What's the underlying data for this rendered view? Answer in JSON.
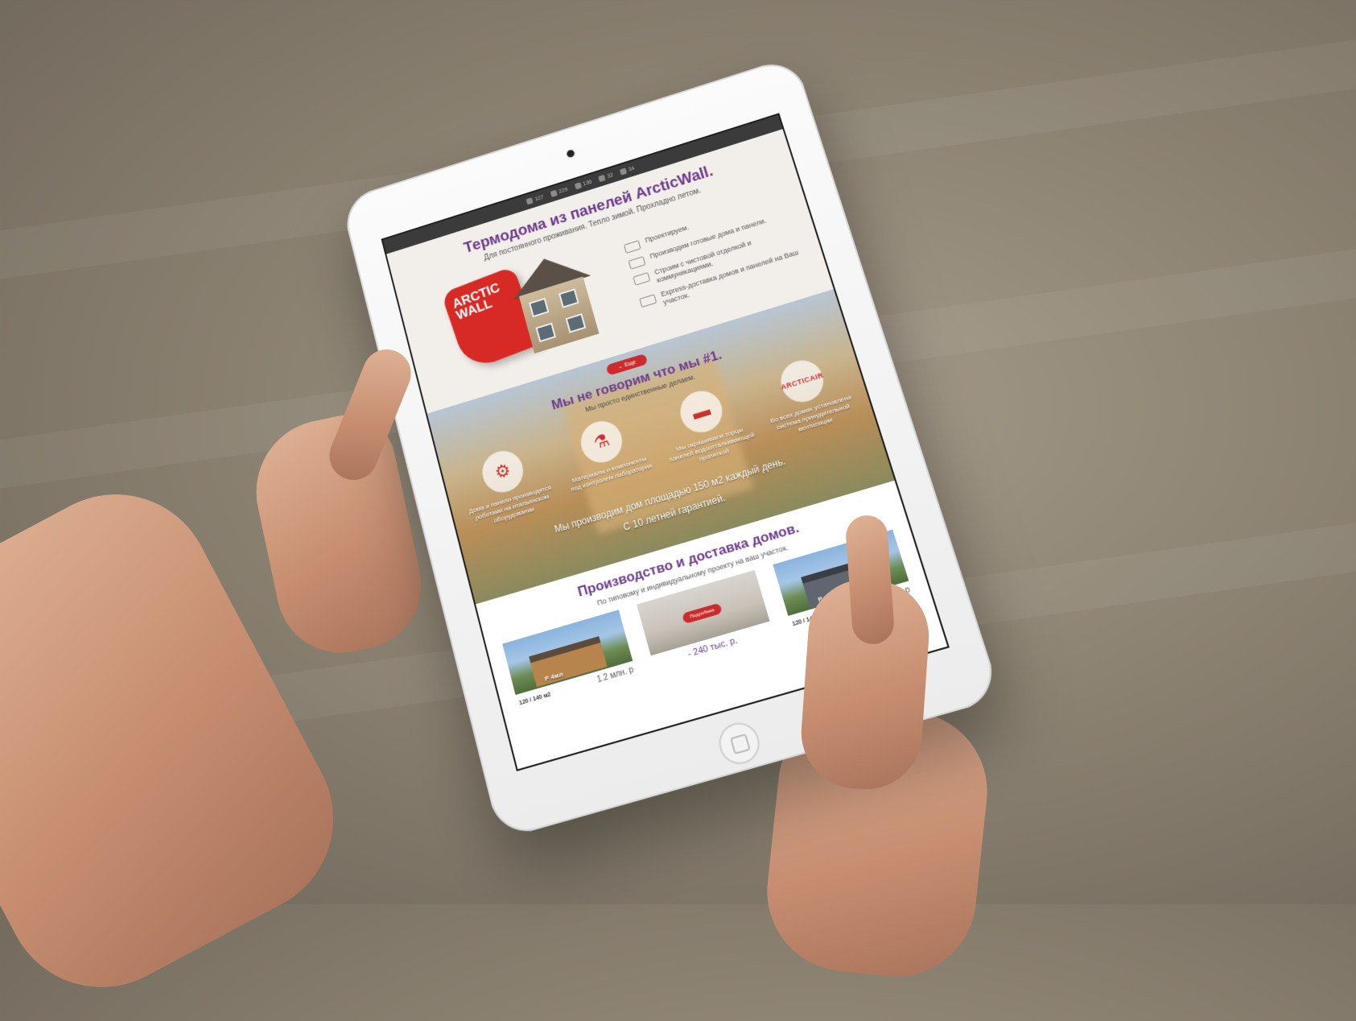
{
  "social": [
    {
      "icon": "twitter-icon",
      "count": "127"
    },
    {
      "icon": "facebook-icon",
      "count": "229"
    },
    {
      "icon": "vk-icon",
      "count": "136"
    },
    {
      "icon": "google-plus-icon",
      "count": "32"
    },
    {
      "icon": "odnoklassniki-icon",
      "count": "34"
    }
  ],
  "hero": {
    "title": "Термодома из панелей ArcticWall.",
    "subtitle": "Для постоянного проживания. Тепло зимой. Прохладно летом.",
    "logo_line1": "ARCTIC",
    "logo_line2": "WALL",
    "features": [
      "Проектируем.",
      "Производим готовые дома и панели.",
      "Строим с чистовой отделкой и коммуникациями.",
      "Express-доставка домов и панелей на Ваш участок."
    ]
  },
  "banner": {
    "more_label": "Еще",
    "title": "Мы не говорим что мы #1.",
    "subtitle": "Мы просто единственные делаем.",
    "advantages": [
      {
        "icon": "robot-arm-icon",
        "glyph": "⚙",
        "text": "Дома и панели производятся роботами на итальянском оборудовании"
      },
      {
        "icon": "lab-flask-icon",
        "glyph": "⚗",
        "text": "Материалы и компоненты под контролем лаборатории"
      },
      {
        "icon": "paint-roller-icon",
        "glyph": "▬",
        "text": "Мы окрашиваем торцы панелей водоотталкивающей пропиткой"
      },
      {
        "icon": "arcticair-fan-icon",
        "glyph": "ARCTICAIR",
        "text": "Во всех домах установлена система принудительной вентиляции"
      }
    ],
    "footer_line1": "Мы производим дом площадью 150 м2 каждый день.",
    "footer_line2": "С 10 летней гарантией."
  },
  "production": {
    "title": "Производство и доставка домов.",
    "subtitle": "По типовому и индивидуальному проекту на ваш участок.",
    "cards": [
      {
        "area": "120 / 140 м2",
        "price": "1.2 млн. р",
        "tag": "Р 4мл"
      },
      {
        "button": "Подробнее",
        "price": "- 240 тыс. р."
      },
      {
        "area": "120 / 145 м2",
        "price": "690 тыс. р",
        "tag": "Р 4567"
      }
    ]
  },
  "colors": {
    "accent": "#cc2b2b",
    "headline": "#6b3b8c",
    "background": "#f1ede8"
  }
}
